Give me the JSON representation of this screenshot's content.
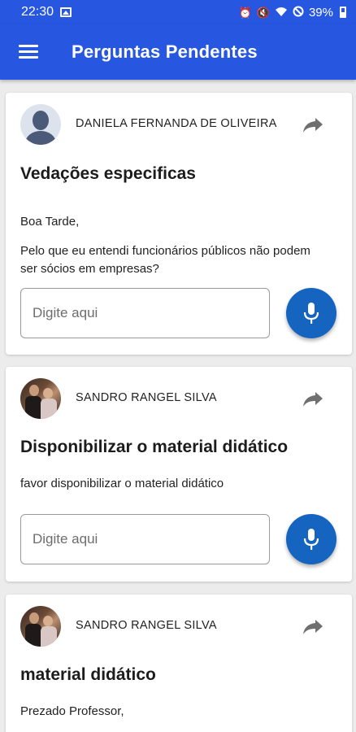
{
  "status_bar": {
    "time": "22:30",
    "battery": "39%"
  },
  "app_bar": {
    "title": "Perguntas Pendentes"
  },
  "colors": {
    "primary": "#2757e0",
    "mic_button": "#1565c0"
  },
  "cards": [
    {
      "author": "DANIELA FERNANDA DE OLIVEIRA",
      "avatar": "default-user-icon",
      "title": "Vedações especificas",
      "body": [
        "Boa Tarde,",
        "Pelo que eu entendi funcionários públicos  não podem ser sócios em empresas?"
      ],
      "input_placeholder": "Digite aqui"
    },
    {
      "author": "SANDRO RANGEL SILVA",
      "avatar": "photo",
      "title": "Disponibilizar o material didático",
      "body": [
        "favor disponibilizar o material didático"
      ],
      "input_placeholder": "Digite aqui"
    },
    {
      "author": "SANDRO RANGEL SILVA",
      "avatar": "photo",
      "title": "material didático",
      "body": [
        "Prezado Professor,"
      ]
    }
  ]
}
